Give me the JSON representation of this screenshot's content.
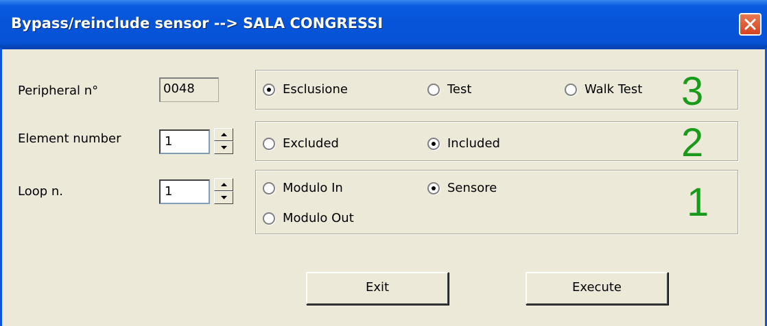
{
  "window": {
    "title": "Bypass/reinclude sensor --> SALA CONGRESSI",
    "close_icon": "close-x-icon"
  },
  "form": {
    "peripheral_label": "Peripheral n°",
    "peripheral_value": "0048",
    "element_label": "Element number",
    "element_value": "1",
    "loop_label": "Loop n.",
    "loop_value": "1"
  },
  "groups": {
    "mode": {
      "number": "3",
      "options": [
        {
          "label": "Esclusione",
          "checked": true
        },
        {
          "label": "Test",
          "checked": false
        },
        {
          "label": "Walk Test",
          "checked": false
        }
      ]
    },
    "state": {
      "number": "2",
      "options": [
        {
          "label": "Excluded",
          "checked": false
        },
        {
          "label": "Included",
          "checked": true
        }
      ]
    },
    "device": {
      "number": "1",
      "options": [
        {
          "label": "Modulo In",
          "checked": false
        },
        {
          "label": "Sensore",
          "checked": true
        },
        {
          "label": "Modulo Out",
          "checked": false
        }
      ]
    }
  },
  "buttons": {
    "exit": "Exit",
    "execute": "Execute"
  },
  "colors": {
    "titlebar": "#0654d8",
    "background": "#ece9d8",
    "group_number": "#1a9a1a"
  }
}
